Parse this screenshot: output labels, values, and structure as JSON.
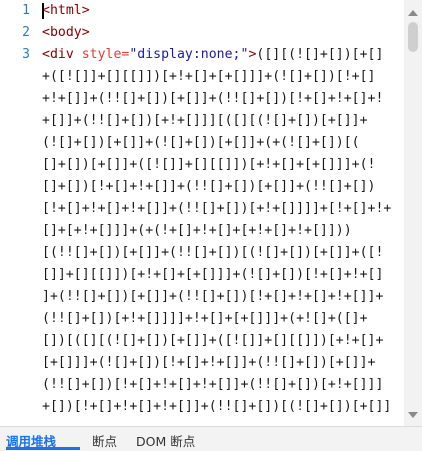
{
  "editor": {
    "line_numbers": [
      "1",
      "2",
      "3"
    ],
    "line1": {
      "tag": "<html>"
    },
    "line2": {
      "tag": "<body>"
    },
    "line3": {
      "tag_open": "<div ",
      "attr": "style=",
      "value": "\"display:none;\"",
      "tag_close": ">",
      "code_start": "([][(![]+[])[+[]"
    },
    "wrapped_lines": [
      "+([![]]+[][[]])[+!+[]+[+[]]]+(![]+[])[!+[]",
      "+!+[]]+(!![]+[])[+[]]+(!![]+[])[!+[]+!+[]+!",
      "+[]]+(!![]+[])[+!+[]]][([][(![]+[])[+[]]+",
      "(![]+[])[+[]]+(![]+[])[+[]]+(+(![]+[])[(",
      "[]+[])[+[]]+([![]]+[][[]])[+!+[]+[+[]]]+(!",
      "[]+[])[!+[]+!+[]]+(!![]+[])[+[]]+(!![]+[])",
      "[!+[]+!+[]+!+[]]+(!![]+[])[+!+[]]]]+[!+[]+!+",
      "[]+[+!+[]]]+(+(!+[]+!+[]+[+!+[]+!+[]]))",
      "[(!![]+[])[+[]]+(!![]+[])[(![]+[])[+[]]+([!",
      "[]]+[][[]])[+!+[]+[+[]]]+(![]+[])[!+[]+!+[]",
      "]+(!![]+[])[+[]]+(!![]+[])[!+[]+!+[]+!+[]]+",
      "(!![]+[])[+!+[]]]]+!+[]+[+[]]]+(+![]+([]+",
      "[])[([][(![]+[])[+[]]+([![]]+[][[]])[+!+[]+",
      "[+[]]]+(![]+[])[!+[]+!+[]]+(!![]+[])[+[]]+",
      "(!![]+[])[!+[]+!+[]+!+[]]+(!![]+[])[+!+[]]]",
      "+[])[!+[]+!+[]+!+[]]+(!![]+[])[(![]+[])[+[]]"
    ]
  },
  "bottom_tabs": [
    "调用堆栈",
    "断点",
    "DOM 断点"
  ],
  "colors": {
    "line_number": "#2b7bb9",
    "tag": "#800000",
    "attr": "#e23d3d",
    "string": "#1a1aa6",
    "active_tab": "#1a73e8"
  }
}
